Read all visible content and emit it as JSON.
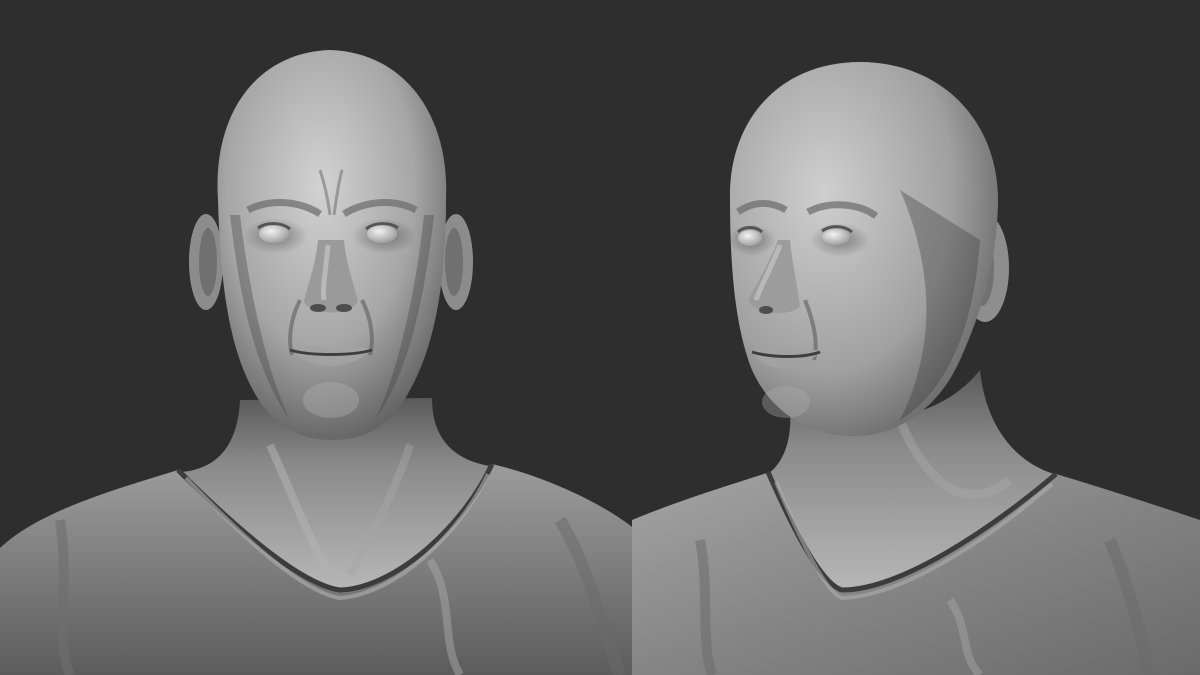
{
  "scene": {
    "background_color": "#2e2e2e",
    "clay_light": "#c4c4c4",
    "clay_mid": "#8e8e8e",
    "clay_dark": "#4a4a4a",
    "subjects": [
      {
        "view": "front"
      },
      {
        "view": "three-quarter"
      }
    ]
  }
}
